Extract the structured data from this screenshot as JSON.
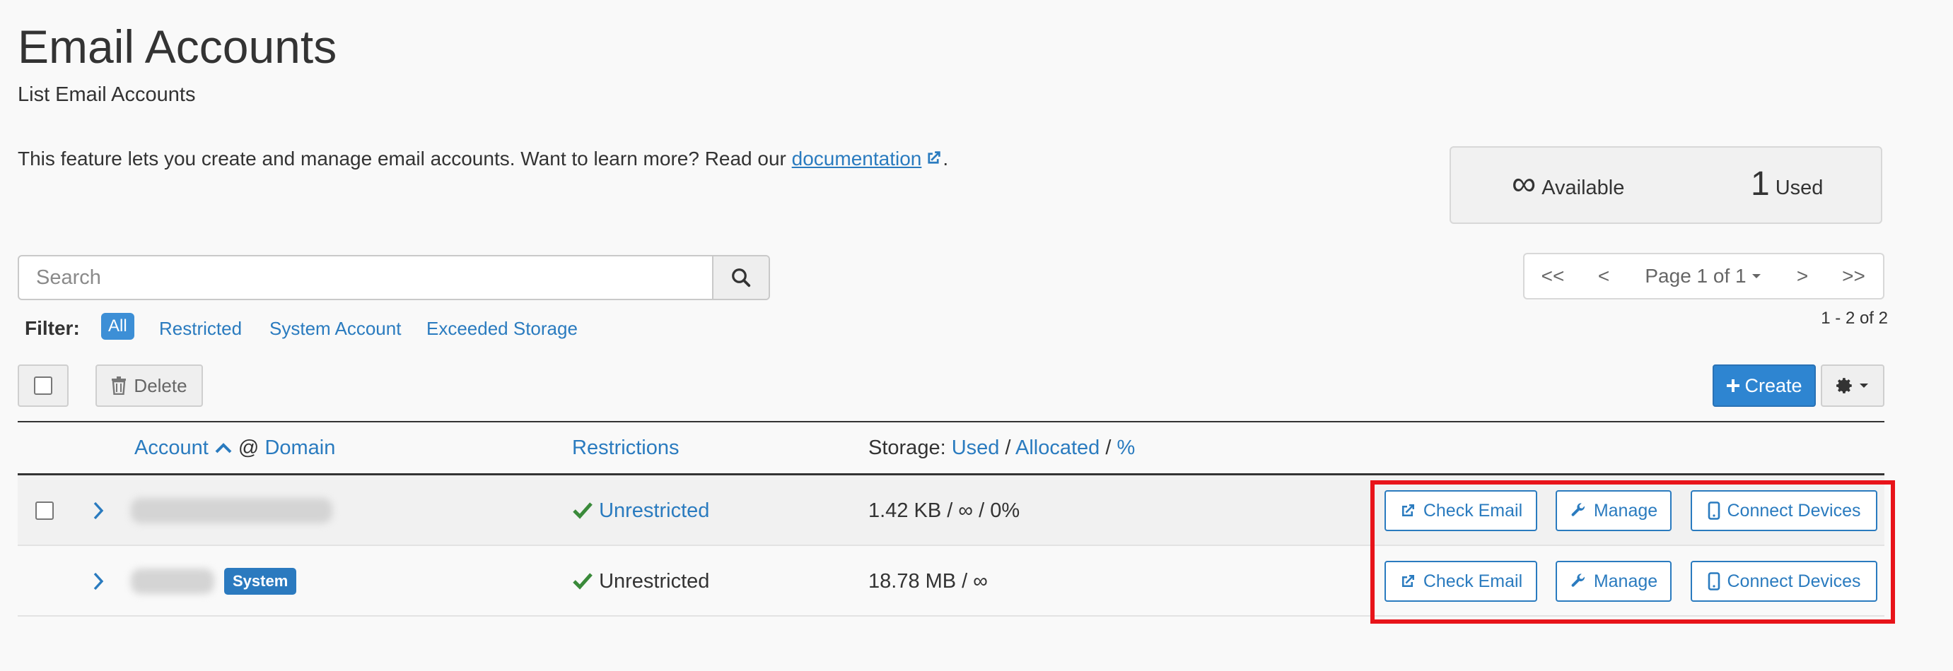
{
  "page": {
    "title": "Email Accounts",
    "subtitle": "List Email Accounts",
    "intro_text": "This feature lets you create and manage email accounts. Want to learn more? Read our ",
    "intro_link": "documentation",
    "intro_end": "."
  },
  "stats": {
    "available_value": "∞",
    "available_label": "Available",
    "used_value": "1",
    "used_label": "Used"
  },
  "search": {
    "placeholder": "Search"
  },
  "filter": {
    "label": "Filter:",
    "items": [
      "All",
      "Restricted",
      "System Account",
      "Exceeded Storage"
    ],
    "active": "All"
  },
  "pagination": {
    "first": "<<",
    "prev": "<",
    "page_label": "Page 1 of 1",
    "next": ">",
    "last": ">>",
    "range": "1 - 2 of 2"
  },
  "toolbar": {
    "delete_label": "Delete",
    "create_label": "Create"
  },
  "table": {
    "headers": {
      "account": "Account",
      "at": "@",
      "domain": "Domain",
      "restrictions": "Restrictions",
      "storage_prefix": "Storage:",
      "storage_used": "Used",
      "storage_sep1": "/",
      "storage_allocated": "Allocated",
      "storage_sep2": "/",
      "storage_percent": "%"
    },
    "rows": [
      {
        "restriction": "Unrestricted",
        "storage": "1.42 KB / ∞ / 0%",
        "actions": [
          "Check Email",
          "Manage",
          "Connect Devices"
        ]
      },
      {
        "badge": "System",
        "restriction": "Unrestricted",
        "storage": "18.78 MB / ∞",
        "actions": [
          "Check Email",
          "Manage",
          "Connect Devices"
        ]
      }
    ]
  },
  "colors": {
    "link": "#2a7bbf",
    "primary_button": "#2e85d1",
    "success_check": "#3a8a3a",
    "highlight": "#e8141a"
  }
}
